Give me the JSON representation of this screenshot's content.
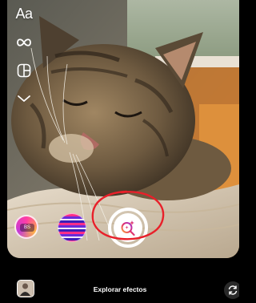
{
  "tools": {
    "text_label": "Aa",
    "items": [
      {
        "icon": "text-icon"
      },
      {
        "icon": "infinity-icon"
      },
      {
        "icon": "layout-icon"
      },
      {
        "icon": "chevron-down-icon"
      }
    ]
  },
  "effects": [
    {
      "name": "effect-thumbnail-1",
      "badge": "BS"
    },
    {
      "name": "effect-thumbnail-2"
    },
    {
      "name": "search-effects-button",
      "icon": "sparkle-search-icon"
    }
  ],
  "bottom": {
    "explore_label": "Explorar efectos",
    "gallery_icon": "gallery-thumbnail-icon",
    "flip_icon": "camera-flip-icon"
  },
  "colors": {
    "accent_gradient": [
      "#f9a23b",
      "#e1306c",
      "#a335d6"
    ],
    "annotation": "#e8202a",
    "background": "#000000"
  }
}
